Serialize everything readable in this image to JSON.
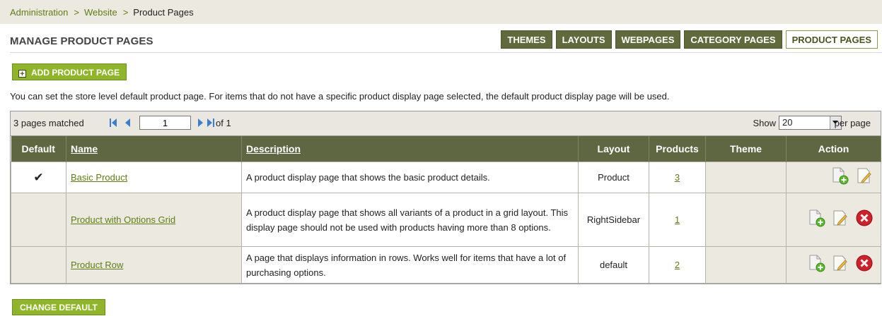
{
  "breadcrumb": {
    "items": [
      "Administration",
      "Website"
    ],
    "current": "Product Pages",
    "separator": ">"
  },
  "page_title": "MANAGE PRODUCT PAGES",
  "tabs": [
    {
      "label": "THEMES"
    },
    {
      "label": "LAYOUTS"
    },
    {
      "label": "WEBPAGES"
    },
    {
      "label": "CATEGORY PAGES"
    },
    {
      "label": "PRODUCT PAGES",
      "active": true
    }
  ],
  "add_button": {
    "label": "ADD PRODUCT PAGE",
    "icon": "plus-icon"
  },
  "info_text": "You can set the store level default product page. For items that do not have a specific product display page selected, the default product display page will be used.",
  "pager": {
    "matched": "3 pages matched",
    "page_value": "1",
    "of_text": "of 1",
    "show_label": "Show",
    "page_size": "20",
    "per_page_label": "per page"
  },
  "table": {
    "headers": {
      "default": "Default",
      "name": "Name",
      "description": "Description",
      "layout": "Layout",
      "products": "Products",
      "theme": "Theme",
      "action": "Action"
    },
    "rows": [
      {
        "default_mark": "✔",
        "name": "Basic Product",
        "description": "A product display page that shows the basic product details.",
        "layout": "Product",
        "products": "3",
        "theme": ""
      },
      {
        "default_mark": "",
        "name": "Product with Options Grid",
        "description": "A product display page that shows all variants of a product in a grid layout. This display page should not be used with products having more than 8 options.",
        "layout": "RightSidebar",
        "products": "1",
        "theme": ""
      },
      {
        "default_mark": "",
        "name": "Product Row",
        "description": "A page that displays information in rows. Works well for items that have a lot of purchasing options.",
        "layout": "default",
        "products": "2",
        "theme": ""
      }
    ]
  },
  "change_button": {
    "label": "CHANGE DEFAULT"
  },
  "colors": {
    "accent_green": "#8fb52a",
    "tab_dark": "#606a3c",
    "header_bg": "#5f6742",
    "link_green": "#5f7d14",
    "delete_red": "#d0202a"
  }
}
